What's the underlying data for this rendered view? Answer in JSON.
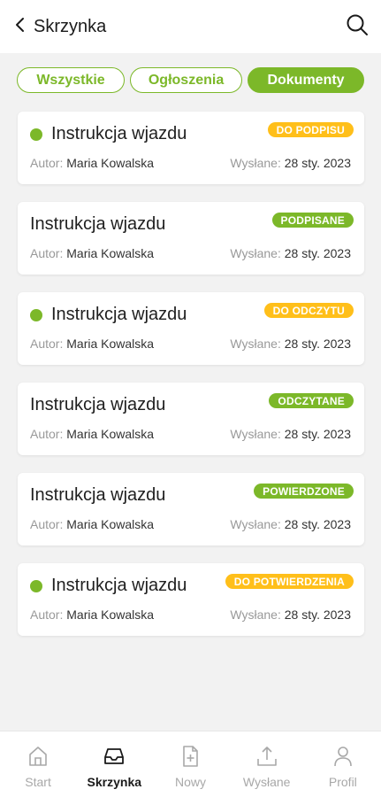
{
  "header": {
    "title": "Skrzynka"
  },
  "tabs": [
    {
      "label": "Wszystkie"
    },
    {
      "label": "Ogłoszenia"
    },
    {
      "label": "Dokumenty"
    }
  ],
  "meta_labels": {
    "author": "Autor:",
    "sent": "Wysłane:"
  },
  "documents": [
    {
      "title": "Instrukcja wjazdu",
      "unread": true,
      "status": "DO PODPISU",
      "status_color": "#ffbf1a",
      "author": "Maria Kowalska",
      "date": "28 sty. 2023"
    },
    {
      "title": "Instrukcja wjazdu",
      "unread": false,
      "status": "PODPISANE",
      "status_color": "#7cb829",
      "author": "Maria Kowalska",
      "date": "28 sty. 2023"
    },
    {
      "title": "Instrukcja wjazdu",
      "unread": true,
      "status": "DO ODCZYTU",
      "status_color": "#ffbf1a",
      "author": "Maria Kowalska",
      "date": "28 sty. 2023"
    },
    {
      "title": "Instrukcja wjazdu",
      "unread": false,
      "status": "ODCZYTANE",
      "status_color": "#7cb829",
      "author": "Maria Kowalska",
      "date": "28 sty. 2023"
    },
    {
      "title": "Instrukcja wjazdu",
      "unread": false,
      "status": "POWIERDZONE",
      "status_color": "#7cb829",
      "author": "Maria Kowalska",
      "date": "28 sty. 2023"
    },
    {
      "title": "Instrukcja wjazdu",
      "unread": true,
      "status": "DO POTWIERDZENIA",
      "status_color": "#ffbf1a",
      "author": "Maria Kowalska",
      "date": "28 sty. 2023"
    }
  ],
  "nav": [
    {
      "label": "Start",
      "icon": "home-icon"
    },
    {
      "label": "Skrzynka",
      "icon": "inbox-icon"
    },
    {
      "label": "Nowy",
      "icon": "new-document-icon"
    },
    {
      "label": "Wysłane",
      "icon": "upload-icon"
    },
    {
      "label": "Profil",
      "icon": "user-icon"
    }
  ],
  "colors": {
    "accent": "#7cb829",
    "warning": "#ffbf1a"
  }
}
